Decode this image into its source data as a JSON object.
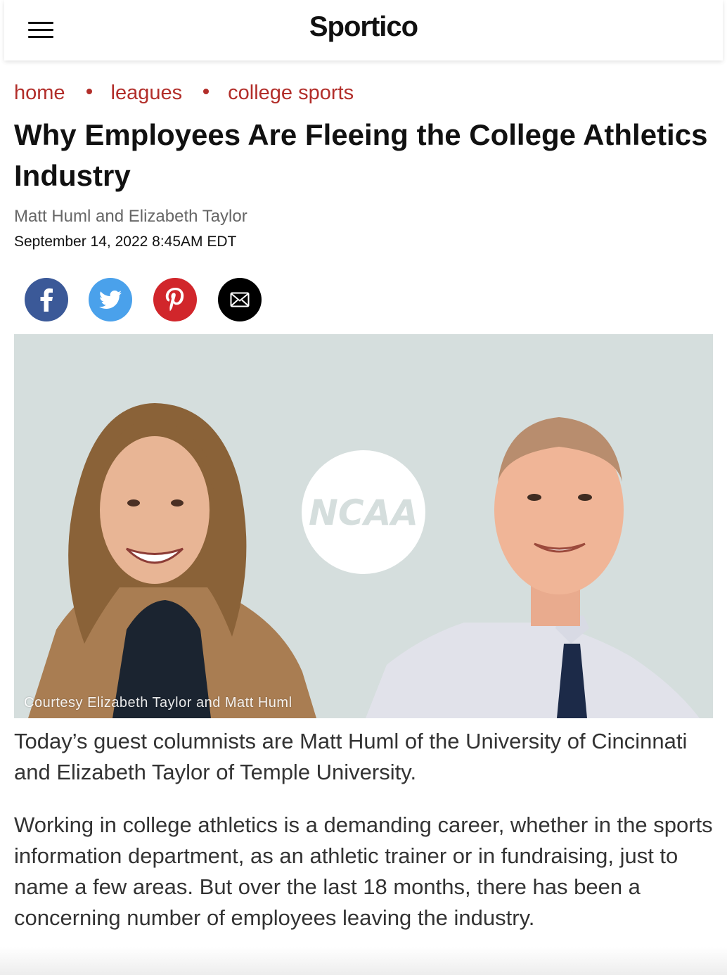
{
  "header": {
    "logo": "Sportico",
    "menu_icon": "hamburger-menu-icon"
  },
  "breadcrumb": [
    {
      "label": "home"
    },
    {
      "label": "leagues"
    },
    {
      "label": "college sports"
    }
  ],
  "article": {
    "title": "Why Employees Are Fleeing the College Athletics Industry",
    "authors": "Matt Huml and Elizabeth Taylor",
    "date": "September 14, 2022 8:45AM EDT",
    "image": {
      "logo_text": "NCAA",
      "caption": "Courtesy Elizabeth Taylor and Matt Huml"
    },
    "lede": "Today’s guest columnists are Matt Huml of the University of Cincinnati and Elizabeth Taylor of Temple University.",
    "paragraph_1": "Working in college athletics is a demanding career, whether in the sports information department, as an athletic trainer or in fundraising, just to name a few areas. But over the last 18 months, there has been a concerning number of employees leaving the industry."
  },
  "share": [
    {
      "network": "facebook",
      "icon": "facebook-icon",
      "color": "#3b5998"
    },
    {
      "network": "twitter",
      "icon": "twitter-icon",
      "color": "#4aa1eb"
    },
    {
      "network": "pinterest",
      "icon": "pinterest-icon",
      "color": "#d1262b"
    },
    {
      "network": "email",
      "icon": "email-icon",
      "color": "#000000"
    }
  ],
  "colors": {
    "accent": "#b22e2a",
    "image_background": "#d5dedd"
  }
}
